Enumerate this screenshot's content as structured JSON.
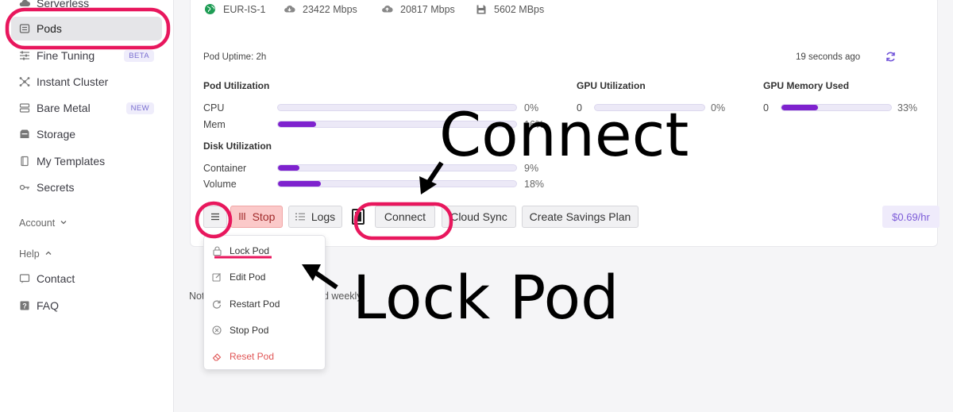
{
  "sidebar": {
    "items": [
      {
        "label": "Serverless",
        "icon": "cloud-icon"
      },
      {
        "label": "Pods",
        "icon": "pod-icon"
      },
      {
        "label": "Fine Tuning",
        "icon": "sliders-icon",
        "badge": "BETA"
      },
      {
        "label": "Instant Cluster",
        "icon": "cluster-icon"
      },
      {
        "label": "Bare Metal",
        "icon": "server-icon",
        "badge": "NEW"
      },
      {
        "label": "Storage",
        "icon": "storage-icon"
      },
      {
        "label": "My Templates",
        "icon": "template-icon"
      },
      {
        "label": "Secrets",
        "icon": "key-icon"
      }
    ],
    "account_label": "Account",
    "help_label": "Help",
    "help_items": [
      {
        "label": "Contact",
        "icon": "chat-icon"
      },
      {
        "label": "FAQ",
        "icon": "question-icon"
      }
    ]
  },
  "pod": {
    "region": "EUR-IS-1",
    "download_speed": "23422 Mbps",
    "upload_speed": "20817 Mbps",
    "disk_speed": "5602 MBps",
    "uptime": "Pod Uptime: 2h",
    "updated": "19 seconds ago",
    "pod_util_heading": "Pod Utilization",
    "gpu_util_heading": "GPU Utilization",
    "gpu_mem_heading": "GPU Memory Used",
    "disk_util_heading": "Disk Utilization",
    "cpu": {
      "label": "CPU",
      "value": "0%",
      "fraction": 0.0
    },
    "mem": {
      "label": "Mem",
      "value": "16%",
      "fraction": 0.16
    },
    "gpu_util": {
      "index": "0",
      "value": "0%",
      "fraction": 0.0
    },
    "gpu_mem": {
      "index": "0",
      "value": "33%",
      "fraction": 0.33
    },
    "container": {
      "label": "Container",
      "value": "9%",
      "fraction": 0.09
    },
    "volume": {
      "label": "Volume",
      "value": "18%",
      "fraction": 0.18
    }
  },
  "actions": {
    "stop": "Stop",
    "logs": "Logs",
    "connect": "Connect",
    "cloud_sync": "Cloud Sync",
    "savings": "Create Savings Plan",
    "price": "$0.69/hr"
  },
  "menu": {
    "items": [
      {
        "label": "Lock Pod"
      },
      {
        "label": "Edit Pod"
      },
      {
        "label": "Restart Pod"
      },
      {
        "label": "Stop Pod"
      },
      {
        "label": "Reset Pod"
      }
    ]
  },
  "note": {
    "prefix": "Not",
    "suffix": "ed weekly"
  },
  "annotations": {
    "connect_label": "Connect",
    "lock_label": "Lock Pod",
    "color": "#e8175d"
  }
}
